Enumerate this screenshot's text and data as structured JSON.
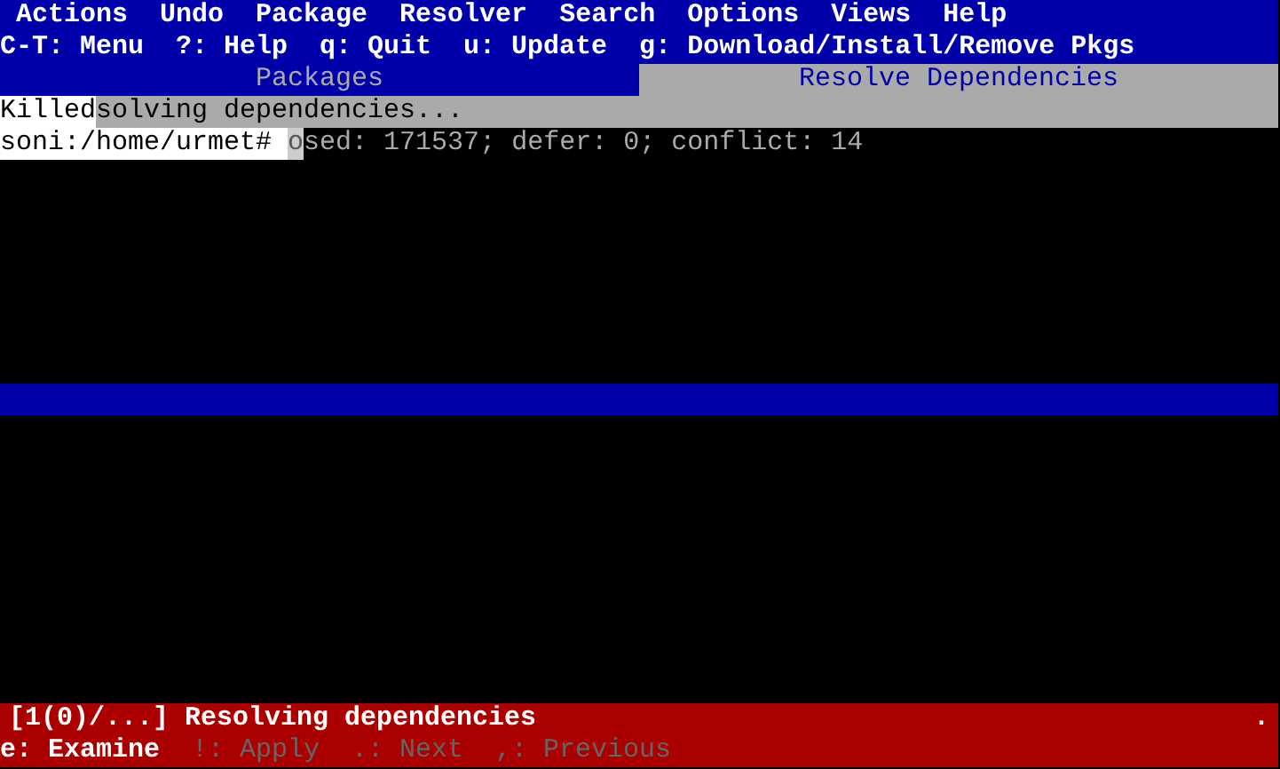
{
  "menu_bar": {
    "items": [
      "Actions",
      "Undo",
      "Package",
      "Resolver",
      "Search",
      "Options",
      "Views",
      "Help"
    ]
  },
  "key_hints": "C-T: Menu  ?: Help  q: Quit  u: Update  g: Download/Install/Remove Pkgs",
  "tabs": [
    {
      "label": "Packages",
      "selected": false
    },
    {
      "label": "Resolve Dependencies",
      "selected": true
    }
  ],
  "output": {
    "killed": "Killed",
    "message": "solving dependencies...",
    "prompt": "soni:/home/urmet# ",
    "cursor": "o",
    "progress": "sed: 171537; defer: 0; conflict: 14"
  },
  "status_bar": {
    "message": "[1(0)/...] Resolving dependencies",
    "indicator": "."
  },
  "actions": [
    {
      "label": "e: Examine",
      "disabled": false
    },
    {
      "label": "!: Apply",
      "disabled": true
    },
    {
      "label": ".: Next",
      "disabled": true
    },
    {
      "label": ",: Previous",
      "disabled": true
    }
  ]
}
